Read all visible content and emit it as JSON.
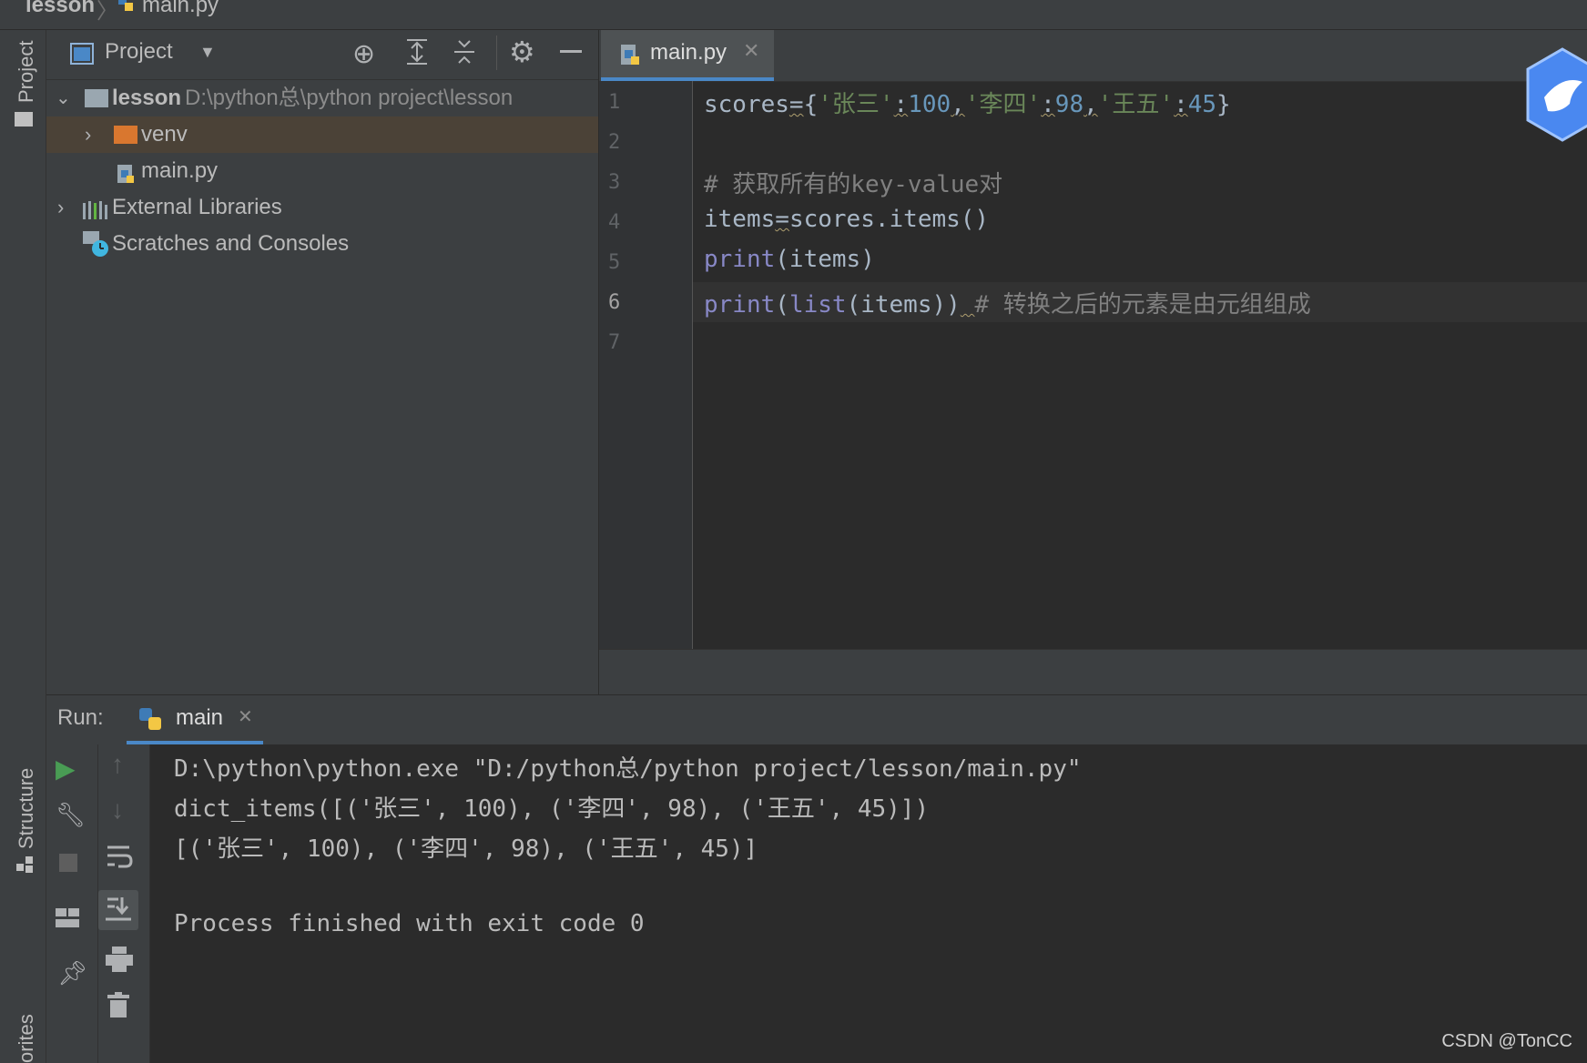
{
  "breadcrumb": {
    "project": "lesson",
    "file": "main.py"
  },
  "left_strip": {
    "project_tab": "Project",
    "structure_tab": "Structure",
    "favorites_tab": "orites"
  },
  "project_panel": {
    "title": "Project",
    "tree": [
      {
        "label": "lesson",
        "path": "D:\\python总\\python project\\lesson",
        "type": "folder",
        "expanded": true
      },
      {
        "label": "venv",
        "type": "folder-excluded",
        "expanded": false,
        "selected": true
      },
      {
        "label": "main.py",
        "type": "python-file"
      },
      {
        "label": "External Libraries",
        "type": "library",
        "expanded": false
      },
      {
        "label": "Scratches and Consoles",
        "type": "scratches"
      }
    ]
  },
  "editor": {
    "tab_label": "main.py",
    "line_numbers": [
      "1",
      "2",
      "3",
      "4",
      "5",
      "6",
      "7"
    ],
    "current_line": 6,
    "lines": {
      "l1_var": "scores",
      "l1_k1": "'张三'",
      "l1_v1": "100",
      "l1_k2": "'李四'",
      "l1_v2": "98",
      "l1_k3": "'王五'",
      "l1_v3": "45",
      "l3_comment": "# 获取所有的key-value对",
      "l4_code": "items",
      "l4_rhs": "scores.items()",
      "l5_fn": "print",
      "l5_arg": "(items)",
      "l6_fn": "print",
      "l6_fn2": "list",
      "l6_arg": "(items))",
      "l6_comment": "# 转换之后的元素是由元组组成"
    }
  },
  "run_panel": {
    "label": "Run:",
    "tab_label": "main",
    "output": [
      "D:\\python\\python.exe \"D:/python总/python project/lesson/main.py\"",
      "dict_items([('张三', 100), ('李四', 98), ('王五', 45)])",
      "[('张三', 100), ('李四', 98), ('王五', 45)]",
      "",
      "Process finished with exit code 0"
    ]
  },
  "watermark": "CSDN @TonCC",
  "colors": {
    "accent": "#4a88c7",
    "run_green": "#499c54",
    "folder_orange": "#d9772f"
  }
}
